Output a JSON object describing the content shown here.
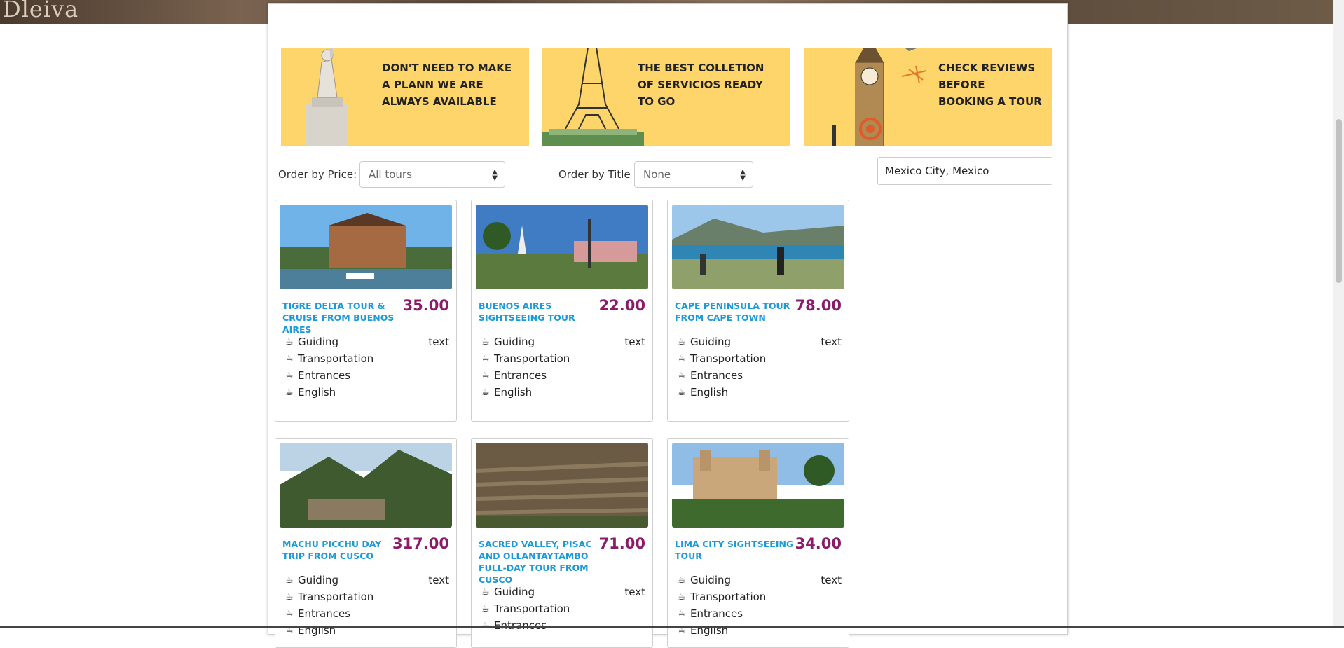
{
  "brand": "Dleiva",
  "banners": [
    {
      "text": "DON'T NEED TO MAKE A PLANN WE ARE ALWAYS AVAILABLE",
      "art": "statue-of-liberty"
    },
    {
      "text": "THE BEST COLLETION OF SERVICIOS READY TO GO",
      "art": "eiffel-tower"
    },
    {
      "text": "CHECK REVIEWS BEFORE BOOKING A TOUR",
      "art": "big-ben"
    }
  ],
  "filters": {
    "price_label": "Order by Price:",
    "price_value": "All tours",
    "title_label": "Order by Title",
    "title_value": "None",
    "location_value": "Mexico City, Mexico"
  },
  "feature_tag": "text",
  "tours": [
    {
      "title": "TIGRE DELTA TOUR & CRUISE FROM BUENOS AIRES",
      "price": "35.00",
      "features": [
        "Guiding",
        "Transportation",
        "Entrances",
        "English"
      ]
    },
    {
      "title": "BUENOS AIRES SIGHTSEEING TOUR",
      "price": "22.00",
      "features": [
        "Guiding",
        "Transportation",
        "Entrances",
        "English"
      ]
    },
    {
      "title": "CAPE PENINSULA TOUR FROM CAPE TOWN",
      "price": "78.00",
      "features": [
        "Guiding",
        "Transportation",
        "Entrances",
        "English"
      ]
    },
    {
      "title": "MACHU PICCHU DAY TRIP FROM CUSCO",
      "price": "317.00",
      "features": [
        "Guiding",
        "Transportation",
        "Entrances",
        "English"
      ]
    },
    {
      "title": "SACRED VALLEY, PISAC AND OLLANTAYTAMBO FULL-DAY TOUR FROM CUSCO",
      "price": "71.00",
      "features": [
        "Guiding",
        "Transportation",
        "Entrances"
      ]
    },
    {
      "title": "LIMA CITY SIGHTSEEING TOUR",
      "price": "34.00",
      "features": [
        "Guiding",
        "Transportation",
        "Entrances",
        "English"
      ]
    }
  ],
  "colors": {
    "banner": "#fdd56a",
    "title": "#1a9ad6",
    "price": "#8b1a6b"
  }
}
